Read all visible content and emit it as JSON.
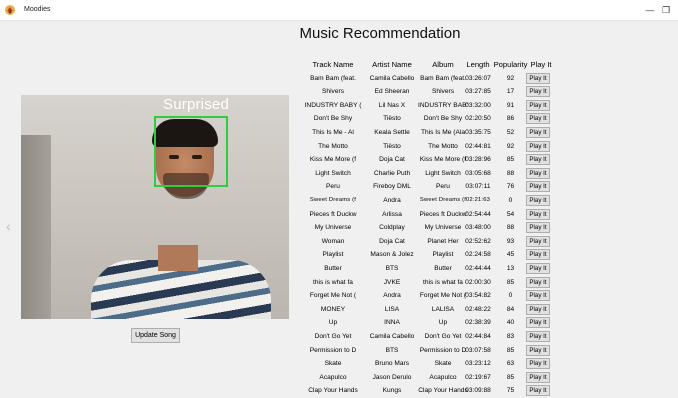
{
  "window": {
    "title": "Moodies",
    "minimize_glyph": "—",
    "maximize_glyph": "❐"
  },
  "heading": "Music Recommendation",
  "camera": {
    "emotion_label": "Surprised",
    "face_box_color": "#2ecc40"
  },
  "nav": {
    "left_glyph": "‹"
  },
  "update_button": "Update Song",
  "table": {
    "headers": {
      "track": "Track Name",
      "artist": "Artist Name",
      "album": "Album",
      "length": "Length",
      "popularity": "Popularity",
      "play": "Play It"
    },
    "rows": [
      {
        "track": "Bam Bam (feat.",
        "artist": "Camila Cabello",
        "album": "Bam Bam (feat.",
        "length": "03:26:07",
        "popularity": "92",
        "play": "Play It"
      },
      {
        "track": "Shivers",
        "artist": "Ed Sheeran",
        "album": "Shivers",
        "length": "03:27:85",
        "popularity": "17",
        "play": "Play It"
      },
      {
        "track": "INDUSTRY BABY (",
        "artist": "Lil Nas X",
        "album": "INDUSTRY BABY (",
        "length": "03:32:00",
        "popularity": "91",
        "play": "Play It"
      },
      {
        "track": "Don't Be Shy",
        "artist": "Tiësto",
        "album": "Don't Be Shy",
        "length": "02:20:50",
        "popularity": "86",
        "play": "Play It"
      },
      {
        "track": "This Is Me - Al",
        "artist": "Keala Settle",
        "album": "This Is Me (Ala",
        "length": "03:35:75",
        "popularity": "52",
        "play": "Play It"
      },
      {
        "track": "The Motto",
        "artist": "Tiësto",
        "album": "The Motto",
        "length": "02:44:81",
        "popularity": "92",
        "play": "Play It"
      },
      {
        "track": "Kiss Me More (f",
        "artist": "Doja Cat",
        "album": "Kiss Me More (f",
        "length": "03:28:96",
        "popularity": "85",
        "play": "Play It"
      },
      {
        "track": "Light Switch",
        "artist": "Charlie Puth",
        "album": "Light Switch",
        "length": "03:05:68",
        "popularity": "88",
        "play": "Play It"
      },
      {
        "track": "Peru",
        "artist": "Fireboy DML",
        "album": "Peru",
        "length": "03:07:11",
        "popularity": "76",
        "play": "Play It"
      },
      {
        "track": "Sweet Dreams (f",
        "artist": "Andra",
        "album": "Sweet Dreams (f",
        "length": "02:21:63",
        "popularity": "0",
        "play": "Play It",
        "small": true
      },
      {
        "track": "Pieces ft Duckw",
        "artist": "Arlissa",
        "album": "Pieces ft Duckw",
        "length": "02:54:44",
        "popularity": "54",
        "play": "Play It"
      },
      {
        "track": "My Universe",
        "artist": "Coldplay",
        "album": "My Universe",
        "length": "03:48:00",
        "popularity": "88",
        "play": "Play It"
      },
      {
        "track": "Woman",
        "artist": "Doja Cat",
        "album": "Planet Her",
        "length": "02:52:62",
        "popularity": "93",
        "play": "Play It"
      },
      {
        "track": "Playlist",
        "artist": "Mason & Jolez",
        "album": "Playlist",
        "length": "02:24:58",
        "popularity": "45",
        "play": "Play It"
      },
      {
        "track": "Butter",
        "artist": "BTS",
        "album": "Butter",
        "length": "02:44:44",
        "popularity": "13",
        "play": "Play It"
      },
      {
        "track": "this is what fa",
        "artist": "JVKE",
        "album": "this is what fa",
        "length": "02:00:30",
        "popularity": "85",
        "play": "Play It"
      },
      {
        "track": "Forget Me Not (",
        "artist": "Andra",
        "album": "Forget Me Not (",
        "length": "03:54:82",
        "popularity": "0",
        "play": "Play It"
      },
      {
        "track": "MONEY",
        "artist": "LISA",
        "album": "LALISA",
        "length": "02:48:22",
        "popularity": "84",
        "play": "Play It"
      },
      {
        "track": "Up",
        "artist": "INNA",
        "album": "Up",
        "length": "02:38:39",
        "popularity": "40",
        "play": "Play It"
      },
      {
        "track": "Don't Go Yet",
        "artist": "Camila Cabello",
        "album": "Don't Go Yet",
        "length": "02:44:84",
        "popularity": "83",
        "play": "Play It"
      },
      {
        "track": "Permission to D",
        "artist": "BTS",
        "album": "Permission to D",
        "length": "03:07:58",
        "popularity": "85",
        "play": "Play It"
      },
      {
        "track": "Skate",
        "artist": "Bruno Mars",
        "album": "Skate",
        "length": "03:23:12",
        "popularity": "63",
        "play": "Play It"
      },
      {
        "track": "Acapulco",
        "artist": "Jason Derulo",
        "album": "Acapulco",
        "length": "02:19:67",
        "popularity": "85",
        "play": "Play It"
      },
      {
        "track": "Clap Your Hands",
        "artist": "Kungs",
        "album": "Clap Your Hands",
        "length": "03:09:88",
        "popularity": "75",
        "play": "Play It"
      }
    ]
  }
}
